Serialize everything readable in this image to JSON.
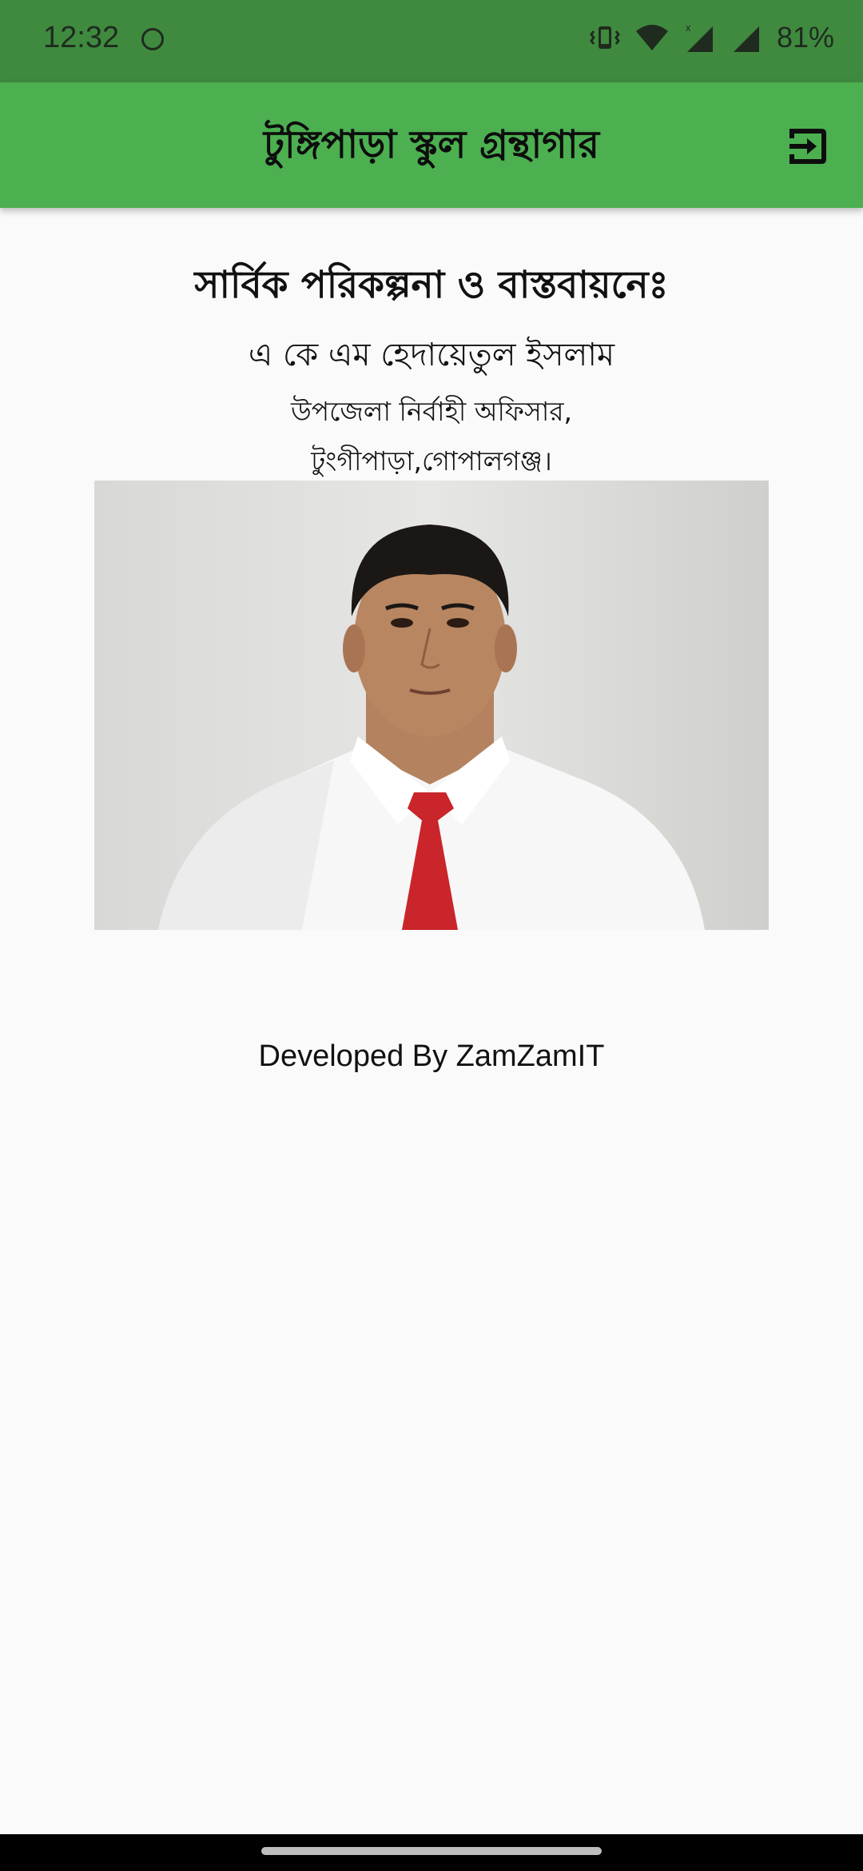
{
  "status_bar": {
    "time": "12:32",
    "battery": "81%",
    "icons": [
      "vibrate-icon",
      "wifi-icon",
      "signal-x-icon",
      "signal-icon"
    ]
  },
  "app_bar": {
    "title": "টুঙ্গিপাড়া স্কুল গ্রন্থাগার",
    "action_icon": "logout-icon"
  },
  "credit": {
    "heading": "সার্বিক পরিকল্পনা ও বাস্তবায়নেঃ",
    "name": "এ কে এম হেদায়েতুল ইসলাম",
    "designation": "উপজেলা নির্বাহী অফিসার,",
    "location": "টুংগীপাড়া,গোপালগঞ্জ।"
  },
  "photo": {
    "subject": "portrait-photo"
  },
  "footer": {
    "developer": "Developed By ZamZamIT"
  },
  "colors": {
    "status_bar": "#3f8a3f",
    "app_bar": "#4caf50",
    "background": "#fafafa"
  }
}
